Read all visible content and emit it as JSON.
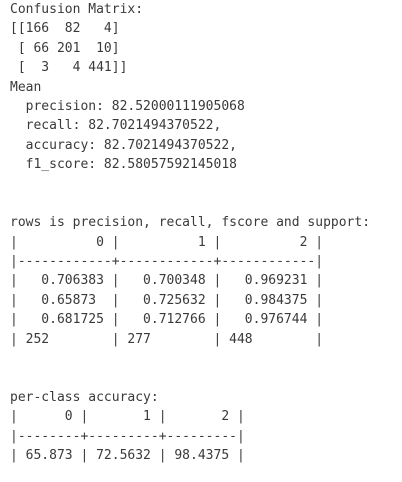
{
  "confusion": {
    "title": "Confusion Matrix:",
    "rows": [
      "[[166  82   4]",
      " [ 66 201  10]",
      " [  3   4 441]]"
    ]
  },
  "mean": {
    "title": "Mean",
    "lines": [
      "  precision: 82.52000111905068",
      "  recall: 82.7021494370522,",
      "  accuracy: 82.7021494370522,",
      "  f1_score: 82.58057592145018"
    ]
  },
  "report": {
    "title": "rows is precision, recall, fscore and support:",
    "lines": [
      "|          0 |          1 |          2 |",
      "|------------+------------+------------|",
      "|   0.706383 |   0.700348 |   0.969231 |",
      "|   0.65873  |   0.725632 |   0.984375 |",
      "|   0.681725 |   0.712766 |   0.976744 |",
      "| 252        | 277        | 448        |"
    ]
  },
  "per_class": {
    "title": "per-class accuracy:",
    "lines": [
      "|      0 |       1 |       2 |",
      "|--------+---------+---------|",
      "| 65.873 | 72.5632 | 98.4375 |"
    ]
  }
}
